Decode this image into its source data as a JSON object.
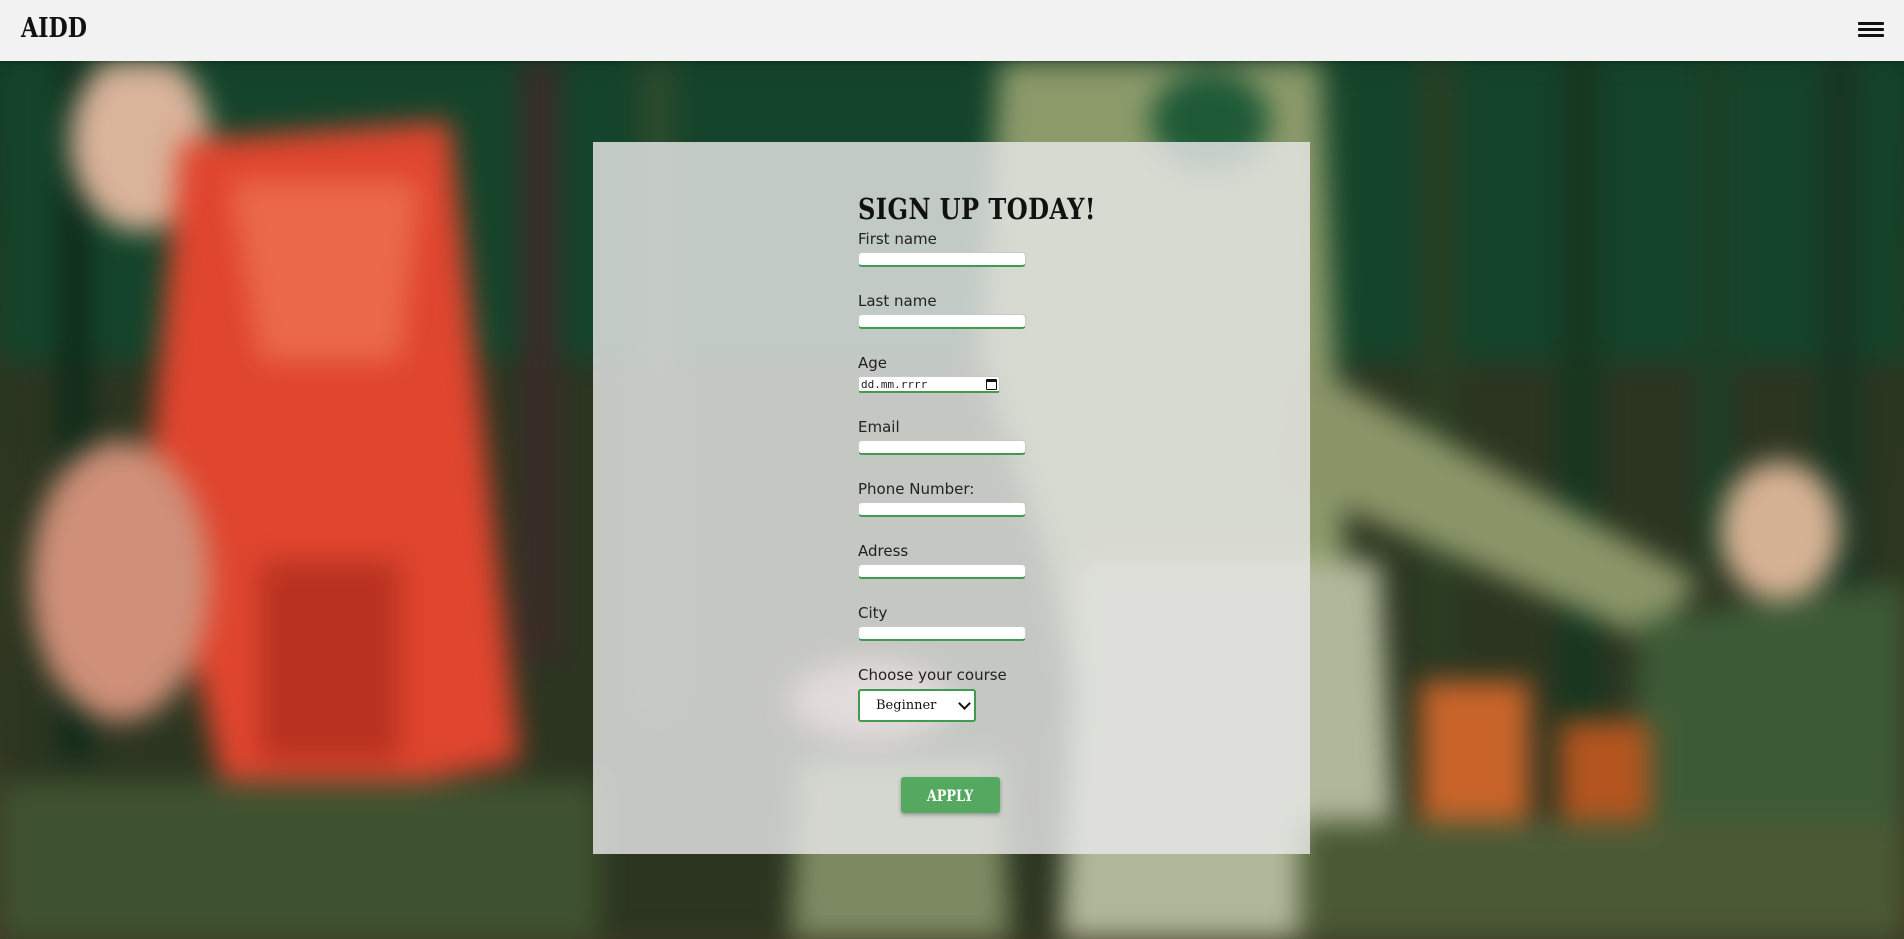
{
  "nav": {
    "logo": "AIDD",
    "menu_icon": "hamburger-menu-icon"
  },
  "form": {
    "title": "SIGN UP TODAY!",
    "fields": {
      "first_name": {
        "label": "First name",
        "value": ""
      },
      "last_name": {
        "label": "Last name",
        "value": ""
      },
      "age": {
        "label": "Age",
        "placeholder": "dd.mm.rrrr"
      },
      "email": {
        "label": "Email",
        "value": ""
      },
      "phone": {
        "label": "Phone Number:",
        "value": ""
      },
      "address": {
        "label": "Adress",
        "value": ""
      },
      "city": {
        "label": "City",
        "value": ""
      }
    },
    "course": {
      "label": "Choose your course",
      "selected": "Beginner"
    },
    "submit_label": "APPLY"
  },
  "colors": {
    "accent": "#3e9b4f",
    "button": "#55a85f",
    "navbar": "#f2f2f2"
  }
}
